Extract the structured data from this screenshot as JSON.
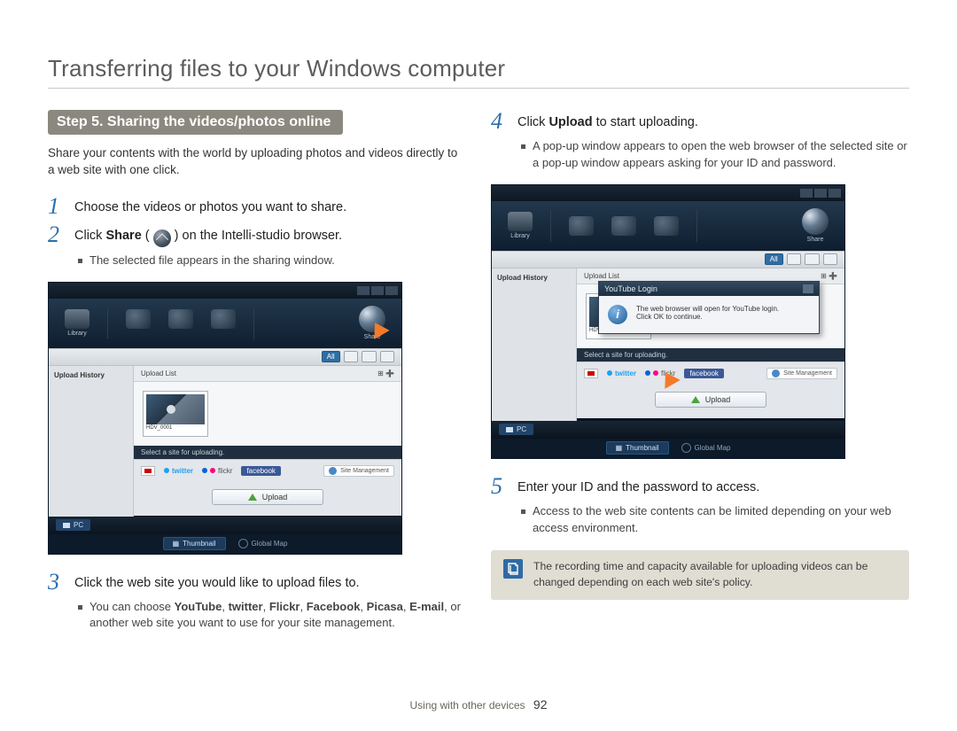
{
  "page": {
    "title": "Transferring files to your Windows computer",
    "step_banner": "Step 5. Sharing the videos/photos online",
    "intro": "Share your contents with the world by uploading photos and videos directly to a web site with one click."
  },
  "left": {
    "item1": {
      "num": "1",
      "text": "Choose the videos or photos you want to share."
    },
    "item2": {
      "num": "2",
      "text_before": "Click ",
      "share_word": "Share",
      "text_after": " ( ",
      "text_tail": " ) on the Intelli-studio browser.",
      "bullet1": "The selected file appears in the sharing window."
    },
    "item3": {
      "num": "3",
      "text": "Click the web site you would like to upload files to.",
      "bullet1_before": "You can choose ",
      "b1": "YouTube",
      "c1": ", ",
      "b2": "twitter",
      "c2": ", ",
      "b3": "Flickr",
      "c3": ", ",
      "b4": "Facebook",
      "c4": ", ",
      "b5": "Picasa",
      "c5": ", ",
      "b6": "E-mail",
      "tail": ", or another web site you want to use for your site management."
    }
  },
  "right": {
    "item4": {
      "num": "4",
      "text_before": "Click ",
      "upload_word": "Upload",
      "text_after": " to start uploading.",
      "bullet1": "A pop-up window appears to open the web browser of the selected site or a pop-up window appears asking for your ID and password."
    },
    "item5": {
      "num": "5",
      "text": "Enter your ID and the password to access.",
      "bullet1": "Access to the web site contents can be limited depending on your web access environment."
    },
    "note": "The recording time and capacity available for uploading videos can be changed depending on each web site's policy."
  },
  "ui1": {
    "side_title": "Upload History",
    "main_head": "Upload List",
    "thumb_cap": "HDV_0001",
    "dark_bar": "Select a site for uploading.",
    "yt": "YouTube",
    "tw": "twitter",
    "fl": "flickr",
    "fb": "facebook",
    "mgmt": "Site Management",
    "upload": "Upload",
    "pc": "PC",
    "thumb_btn": "Thumbnail",
    "map_btn": "Global Map",
    "pill_all": "All",
    "tool_lib": "Library",
    "tool_share": "Share"
  },
  "ui2": {
    "dialog_title": "YouTube Login",
    "dialog_msg1": "The web browser will open for YouTube login.",
    "dialog_msg2": "Click OK to continue."
  },
  "footer": {
    "section": "Using with other devices",
    "page_number": "92"
  }
}
